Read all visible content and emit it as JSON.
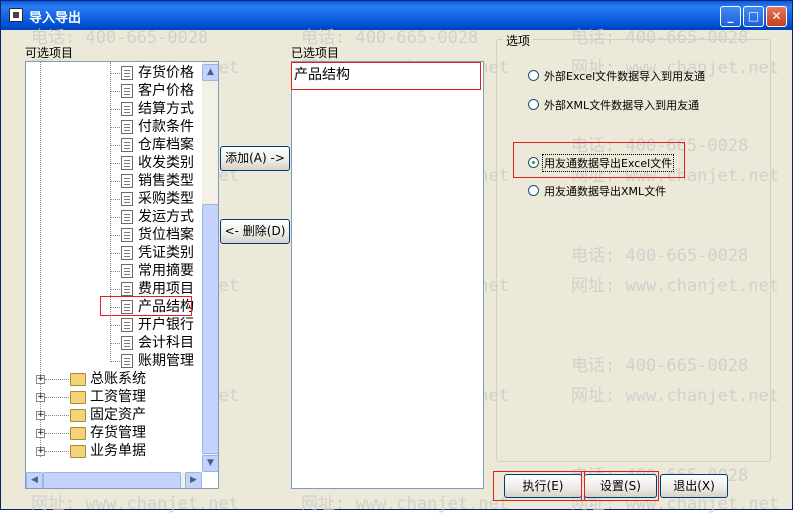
{
  "window": {
    "title": "导入导出"
  },
  "watermarks": {
    "phone": "电话: 400-665-0028",
    "site": "网址: www.chanjet.net"
  },
  "left_panel": {
    "label": "可选项目",
    "items": [
      "存货价格",
      "客户价格",
      "结算方式",
      "付款条件",
      "仓库档案",
      "收发类别",
      "销售类型",
      "采购类型",
      "发运方式",
      "货位档案",
      "凭证类别",
      "常用摘要",
      "费用项目",
      "产品结构",
      "开户银行",
      "会计科目",
      "账期管理"
    ],
    "selected": "产品结构",
    "folders": [
      "总账系统",
      "工资管理",
      "固定资产",
      "存货管理",
      "业务单据"
    ]
  },
  "middle": {
    "add_label": "添加(A) ->",
    "remove_label": "<- 删除(D)"
  },
  "right_list": {
    "label": "已选项目",
    "items": [
      "产品结构"
    ]
  },
  "options": {
    "label": "选项",
    "radios": [
      "外部Excel文件数据导入到用友通",
      "外部XML文件数据导入到用友通",
      "用友通数据导出Excel文件",
      "用友通数据导出XML文件"
    ],
    "selected_index": 2
  },
  "buttons": {
    "execute": "执行(E)",
    "settings": "设置(S)",
    "exit": "退出(X)"
  }
}
